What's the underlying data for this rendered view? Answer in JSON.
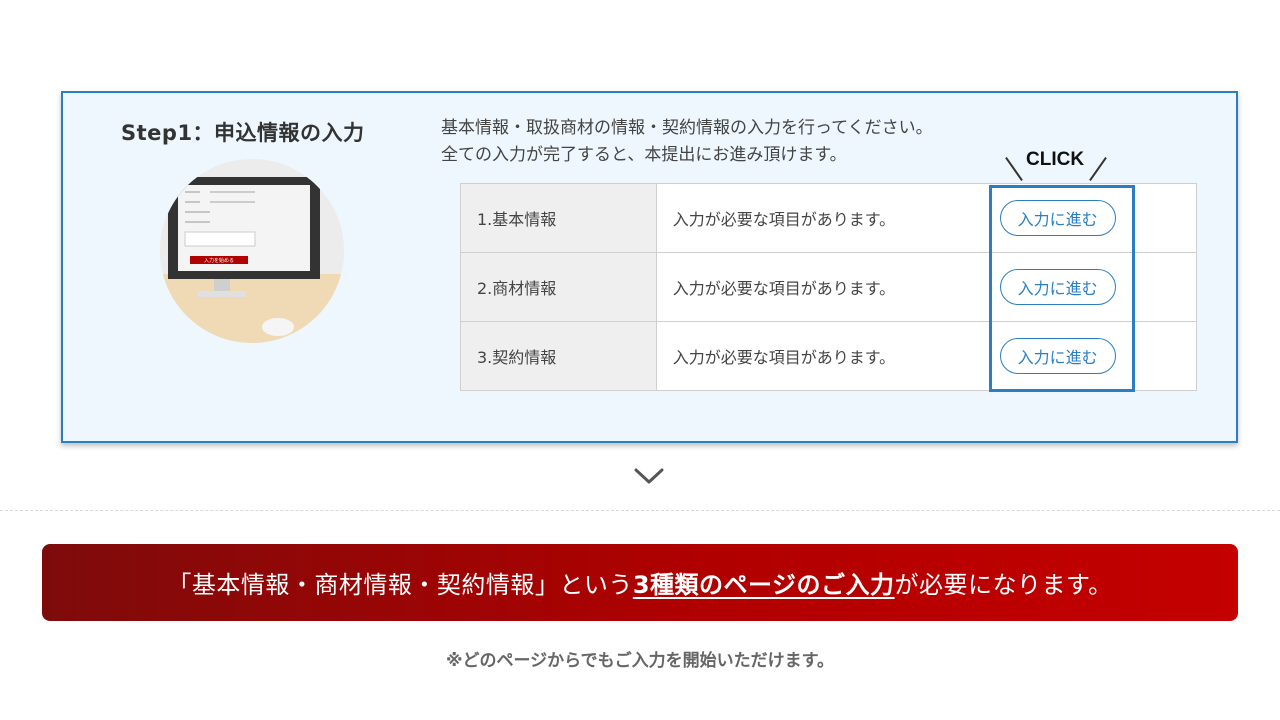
{
  "step": {
    "title": "Step1：申込情報の入力",
    "description": [
      "基本情報・取扱商材の情報・契約情報の入力を行ってください。",
      "全ての入力が完了すると、本提出にお進み頂けます。"
    ],
    "click_label": "CLICK",
    "rows": [
      {
        "name": "1.基本情報",
        "status": "入力が必要な項目があります。",
        "button": "入力に進む"
      },
      {
        "name": "2.商材情報",
        "status": "入力が必要な項目があります。",
        "button": "入力に進む"
      },
      {
        "name": "3.契約情報",
        "status": "入力が必要な項目があります。",
        "button": "入力に進む"
      }
    ],
    "illustration_button": "入力を始める"
  },
  "banner": {
    "prefix": "「基本情報・商材情報・契約情報」という",
    "emphasis": "3種類のページのご入力",
    "suffix": "が必要になります。"
  },
  "note": "※どのページからでもご入力を開始いただけます。",
  "colors": {
    "accent": "#2a7fc4",
    "card_bg": "#eef7fd",
    "banner_dark": "#7e0b0b",
    "banner_light": "#c40000"
  },
  "icons": [
    "chevron-down-icon",
    "monitor-illustration"
  ]
}
